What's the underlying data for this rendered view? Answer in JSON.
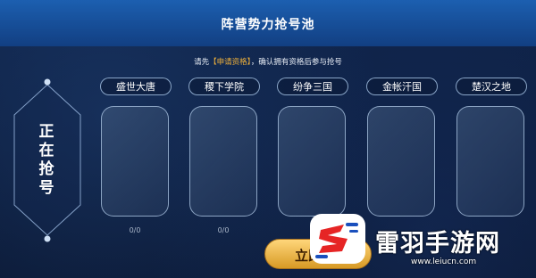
{
  "header": {
    "title": "阵营势力抢号池"
  },
  "notice": {
    "before": "请先",
    "link": "【申请资格】",
    "after": "，确认拥有资格后参与抢号"
  },
  "side": {
    "chars": [
      "正",
      "在",
      "抢",
      "号"
    ]
  },
  "factions": [
    {
      "label": "盛世大唐",
      "count": "0/0"
    },
    {
      "label": "稷下学院",
      "count": "0/0"
    },
    {
      "label": "纷争三国",
      "count": ""
    },
    {
      "label": "金帐汗国",
      "count": ""
    },
    {
      "label": "楚汉之地",
      "count": ""
    }
  ],
  "grab_button": {
    "label": "立即"
  },
  "watermark": {
    "title": "雷羽手游网",
    "url": "www.leiucn.com"
  },
  "colors": {
    "header_top": "#1c5fb0",
    "accent_gold": "#f0b13a",
    "logo_red": "#e62525",
    "logo_blue": "#1a4fbd"
  }
}
